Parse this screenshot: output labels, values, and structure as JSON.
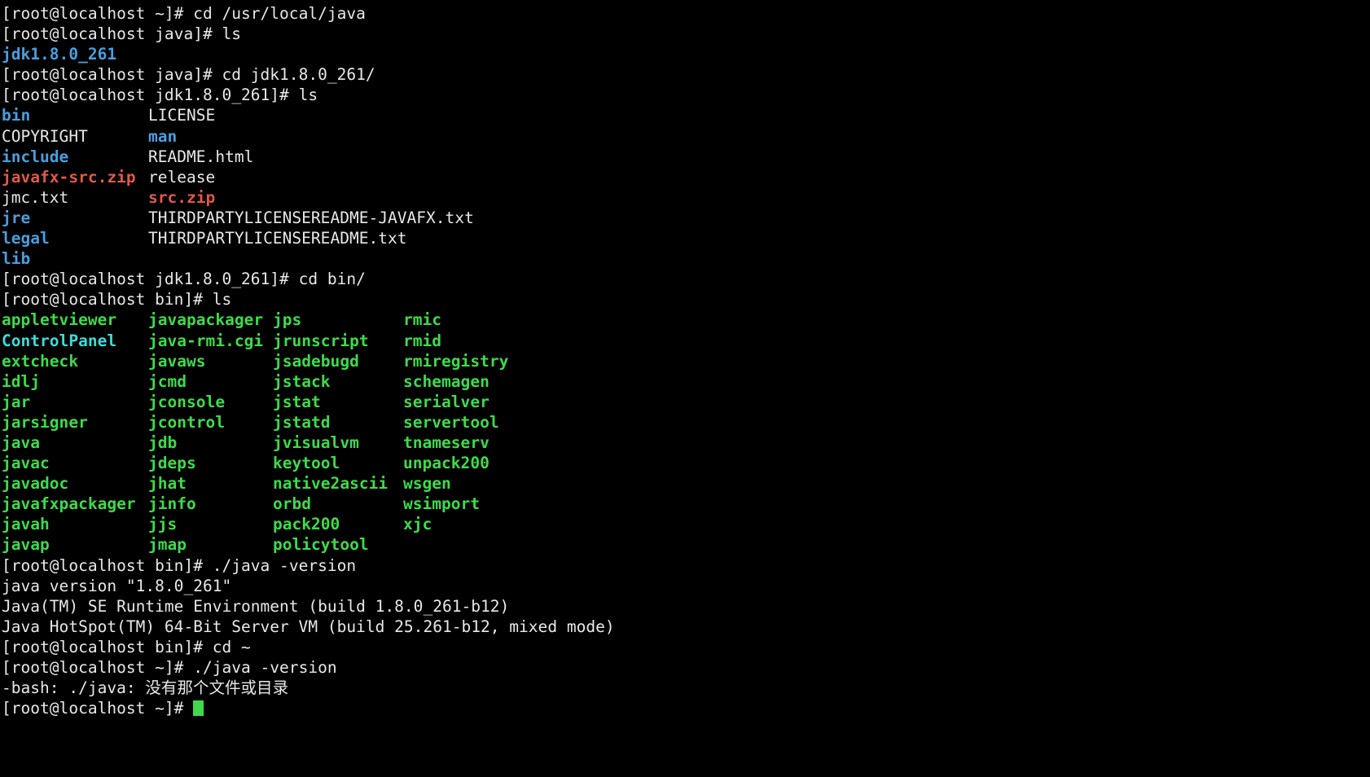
{
  "terminal": {
    "title": "root@localhost terminal",
    "background_color": "#000000",
    "colors": {
      "text": "#e8e8e8",
      "directory": "#4a9ee0",
      "archive": "#e2584a",
      "executable": "#3ddb4a",
      "symlink": "#3ddbdb",
      "cursor": "#3ddb4a"
    },
    "prompts": {
      "home": "[root@localhost ~]# ",
      "java": "[root@localhost java]# ",
      "jdk": "[root@localhost jdk1.8.0_261]# ",
      "bin": "[root@localhost bin]# "
    },
    "commands": {
      "cd_usr_local_java": "cd /usr/local/java",
      "ls": "ls",
      "cd_jdk": "cd jdk1.8.0_261/",
      "cd_bin": "cd bin/",
      "java_version": "./java -version",
      "cd_home": "cd ~"
    },
    "java_dir_listing": [
      "jdk1.8.0_261"
    ],
    "jdk_listing": [
      {
        "left": "bin",
        "left_type": "dir",
        "right": "LICENSE",
        "right_type": "file"
      },
      {
        "left": "COPYRIGHT",
        "left_type": "file",
        "right": "man",
        "right_type": "dir"
      },
      {
        "left": "include",
        "left_type": "dir",
        "right": "README.html",
        "right_type": "file"
      },
      {
        "left": "javafx-src.zip",
        "left_type": "archive",
        "right": "release",
        "right_type": "file"
      },
      {
        "left": "jmc.txt",
        "left_type": "file",
        "right": "src.zip",
        "right_type": "archive"
      },
      {
        "left": "jre",
        "left_type": "dir",
        "right": "THIRDPARTYLICENSEREADME-JAVAFX.txt",
        "right_type": "file"
      },
      {
        "left": "legal",
        "left_type": "dir",
        "right": "THIRDPARTYLICENSEREADME.txt",
        "right_type": "file"
      },
      {
        "left": "lib",
        "left_type": "dir",
        "right": "",
        "right_type": "file"
      }
    ],
    "bin_listing": [
      {
        "c1": "appletviewer",
        "c1_type": "exec",
        "c2": "javapackager",
        "c2_type": "exec",
        "c3": "jps",
        "c3_type": "exec",
        "c4": "rmic",
        "c4_type": "exec"
      },
      {
        "c1": "ControlPanel",
        "c1_type": "symlink",
        "c2": "java-rmi.cgi",
        "c2_type": "exec",
        "c3": "jrunscript",
        "c3_type": "exec",
        "c4": "rmid",
        "c4_type": "exec"
      },
      {
        "c1": "extcheck",
        "c1_type": "exec",
        "c2": "javaws",
        "c2_type": "exec",
        "c3": "jsadebugd",
        "c3_type": "exec",
        "c4": "rmiregistry",
        "c4_type": "exec"
      },
      {
        "c1": "idlj",
        "c1_type": "exec",
        "c2": "jcmd",
        "c2_type": "exec",
        "c3": "jstack",
        "c3_type": "exec",
        "c4": "schemagen",
        "c4_type": "exec"
      },
      {
        "c1": "jar",
        "c1_type": "exec",
        "c2": "jconsole",
        "c2_type": "exec",
        "c3": "jstat",
        "c3_type": "exec",
        "c4": "serialver",
        "c4_type": "exec"
      },
      {
        "c1": "jarsigner",
        "c1_type": "exec",
        "c2": "jcontrol",
        "c2_type": "exec",
        "c3": "jstatd",
        "c3_type": "exec",
        "c4": "servertool",
        "c4_type": "exec"
      },
      {
        "c1": "java",
        "c1_type": "exec",
        "c2": "jdb",
        "c2_type": "exec",
        "c3": "jvisualvm",
        "c3_type": "exec",
        "c4": "tnameserv",
        "c4_type": "exec"
      },
      {
        "c1": "javac",
        "c1_type": "exec",
        "c2": "jdeps",
        "c2_type": "exec",
        "c3": "keytool",
        "c3_type": "exec",
        "c4": "unpack200",
        "c4_type": "exec"
      },
      {
        "c1": "javadoc",
        "c1_type": "exec",
        "c2": "jhat",
        "c2_type": "exec",
        "c3": "native2ascii",
        "c3_type": "exec",
        "c4": "wsgen",
        "c4_type": "exec"
      },
      {
        "c1": "javafxpackager",
        "c1_type": "exec",
        "c2": "jinfo",
        "c2_type": "exec",
        "c3": "orbd",
        "c3_type": "exec",
        "c4": "wsimport",
        "c4_type": "exec"
      },
      {
        "c1": "javah",
        "c1_type": "exec",
        "c2": "jjs",
        "c2_type": "exec",
        "c3": "pack200",
        "c3_type": "exec",
        "c4": "xjc",
        "c4_type": "exec"
      },
      {
        "c1": "javap",
        "c1_type": "exec",
        "c2": "jmap",
        "c2_type": "exec",
        "c3": "policytool",
        "c3_type": "exec",
        "c4": "",
        "c4_type": "exec"
      }
    ],
    "version_output": [
      "java version \"1.8.0_261\"",
      "Java(TM) SE Runtime Environment (build 1.8.0_261-b12)",
      "Java HotSpot(TM) 64-Bit Server VM (build 25.261-b12, mixed mode)"
    ],
    "error_prefix": "-bash: ./java: ",
    "error_message": "没有那个文件或目录"
  }
}
